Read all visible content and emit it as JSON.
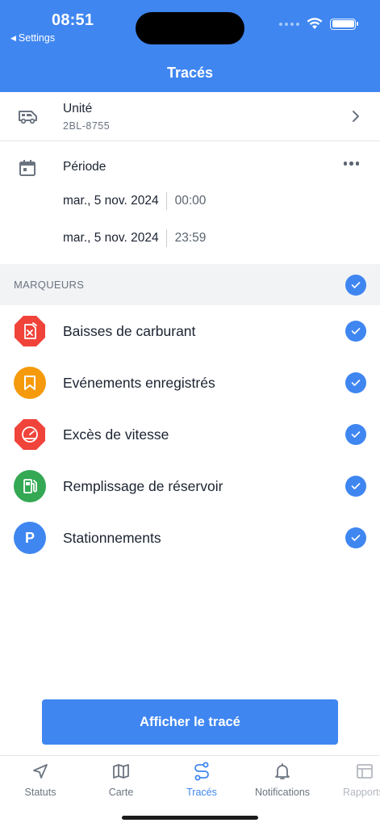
{
  "status_bar": {
    "time": "08:51",
    "back_label": "Settings"
  },
  "header": {
    "title": "Tracés"
  },
  "unit": {
    "label": "Unité",
    "value": "2BL-8755",
    "icon": "van-icon"
  },
  "period": {
    "label": "Période",
    "icon": "calendar-icon",
    "start": {
      "date": "mar., 5 nov. 2024",
      "time": "00:00"
    },
    "end": {
      "date": "mar., 5 nov. 2024",
      "time": "23:59"
    }
  },
  "markers": {
    "section_title": "MARQUEURS",
    "all_checked": true,
    "items": [
      {
        "label": "Baisses de carburant",
        "icon": "fuel-drop-icon",
        "color": "#f0433a",
        "checked": true
      },
      {
        "label": "Evénements enregistrés",
        "icon": "bookmark-icon",
        "color": "#f59a0c",
        "checked": true
      },
      {
        "label": "Excès de vitesse",
        "icon": "speedometer-icon",
        "color": "#f0433a",
        "checked": true
      },
      {
        "label": "Remplissage de réservoir",
        "icon": "fuel-pump-icon",
        "color": "#34a853",
        "checked": true
      },
      {
        "label": "Stationnements",
        "icon": "parking-icon",
        "icon_text": "P",
        "color": "#3f86f1",
        "checked": true
      }
    ]
  },
  "actions": {
    "show_track": "Afficher le tracé"
  },
  "tabbar": {
    "tabs": [
      {
        "label": "Statuts",
        "icon": "navigation-arrow-icon",
        "active": false
      },
      {
        "label": "Carte",
        "icon": "map-icon",
        "active": false
      },
      {
        "label": "Tracés",
        "icon": "route-icon",
        "active": true
      },
      {
        "label": "Notifications",
        "icon": "bell-icon",
        "active": false
      },
      {
        "label": "Rapports",
        "icon": "table-icon",
        "active": false
      }
    ]
  },
  "colors": {
    "accent": "#3f86f1",
    "text": "#1b2230",
    "muted": "#6b7480"
  }
}
